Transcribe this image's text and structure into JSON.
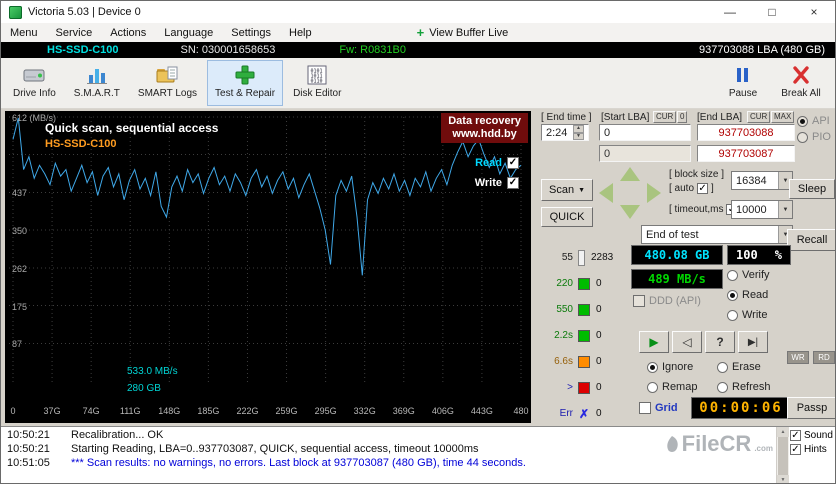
{
  "window": {
    "title": "Victoria 5.03 | Device 0"
  },
  "icons": {
    "minimize": "—",
    "maximize": "□",
    "close": "×",
    "view_buffer_plus": "+",
    "combo_arrow": "▼",
    "spinner_up": "▲",
    "spinner_down": "▼"
  },
  "menu": {
    "items": [
      "Menu",
      "Service",
      "Actions",
      "Language",
      "Settings",
      "Help"
    ],
    "buffer_live": "View Buffer Live"
  },
  "device": {
    "model": "HS-SSD-C100",
    "serial": "SN: 030001658653",
    "firmware": "Fw: R0831B0",
    "capacity": "937703088 LBA (480 GB)"
  },
  "toolbar": {
    "buttons": [
      {
        "label": "Drive Info"
      },
      {
        "label": "S.M.A.R.T"
      },
      {
        "label": "SMART Logs"
      },
      {
        "label": "Test & Repair",
        "active": true
      },
      {
        "label": "Disk Editor"
      }
    ],
    "pause": "Pause",
    "break_all": "Break All"
  },
  "graph": {
    "title": "Quick scan, sequential access",
    "subtitle": "HS-SSD-C100",
    "watermark_line1": "Data recovery",
    "watermark_line2": "www.hdd.by",
    "read_label": "Read",
    "write_label": "Write",
    "marker_speed": "533.0 MB/s",
    "marker_pos": "280 GB"
  },
  "chart_data": {
    "type": "line",
    "title": "Quick scan, sequential access",
    "ylabel": "MB/s",
    "ylim": [
      0,
      612
    ],
    "xlim": [
      0,
      480
    ],
    "grid": true,
    "y_ticks": [
      612,
      525,
      437,
      350,
      262,
      175,
      87
    ],
    "y_tick_labels": [
      "612 (MB/s)",
      "",
      "437",
      "350",
      "262",
      "175",
      "87"
    ],
    "x_tick_labels": [
      "0",
      "37G",
      "74G",
      "111G",
      "148G",
      "185G",
      "222G",
      "259G",
      "295G",
      "332G",
      "369G",
      "406G",
      "443G",
      "480"
    ],
    "series_color": "#3fa8e8",
    "legend": [
      "Read",
      "Write"
    ],
    "x": [
      0,
      5,
      10,
      15,
      20,
      25,
      30,
      35,
      40,
      45,
      50,
      55,
      60,
      65,
      70,
      75,
      80,
      85,
      90,
      95,
      100,
      105,
      110,
      115,
      120,
      125,
      130,
      135,
      140,
      145,
      150,
      155,
      160,
      165,
      170,
      175,
      180,
      185,
      190,
      195,
      200,
      205,
      210,
      215,
      220,
      225,
      230,
      235,
      240,
      245,
      250,
      255,
      260,
      265,
      270,
      275,
      280,
      285,
      290,
      295,
      300,
      305,
      310,
      315,
      320,
      325,
      330,
      335,
      340,
      345,
      350,
      355,
      360,
      365,
      370,
      375,
      380,
      385,
      390,
      395,
      400,
      405,
      410,
      415,
      420,
      425,
      430,
      435,
      440,
      445,
      450,
      455,
      460,
      465,
      470,
      475,
      480
    ],
    "values": [
      560,
      610,
      490,
      520,
      470,
      500,
      480,
      455,
      505,
      475,
      490,
      440,
      470,
      500,
      460,
      485,
      430,
      475,
      495,
      450,
      480,
      420,
      465,
      490,
      445,
      470,
      430,
      485,
      405,
      380,
      450,
      475,
      440,
      490,
      460,
      480,
      435,
      470,
      495,
      455,
      475,
      440,
      480,
      460,
      430,
      470,
      490,
      450,
      475,
      435,
      465,
      485,
      445,
      470,
      425,
      455,
      480,
      440,
      400,
      350,
      270,
      430,
      465,
      440,
      475,
      380,
      245,
      420,
      460,
      435,
      470,
      445,
      480,
      440,
      465,
      430,
      470,
      450,
      485,
      440,
      470,
      490,
      455,
      500,
      530,
      555,
      520,
      545,
      560,
      525,
      495,
      520,
      480,
      505,
      470,
      490,
      500
    ]
  },
  "controls": {
    "end_time_label": "[ End time ]",
    "end_time": "2:24",
    "start_lba_label": "[Start LBA]",
    "end_lba_label": "[End LBA]",
    "cur": "CUR",
    "zero": "0",
    "max": "MAX",
    "start_lba": "0",
    "current_lba": "0",
    "end_lba": "937703088",
    "end_lba_current": "937703087",
    "scan": "Scan",
    "quick": "QUICK",
    "block_size_label": "[ block size ]",
    "auto_label": "[ auto",
    "bracket": "]",
    "block_size": "16384",
    "timeout_label": "[ timeout,ms",
    "timeout": "10000",
    "end_of_test": "End of test",
    "api": "API",
    "pio": "PIO",
    "sleep": "Sleep",
    "recall": "Recall",
    "passp": "Passp",
    "wr": "WR",
    "rd": "RD"
  },
  "bins": [
    {
      "label": "55",
      "count": "2283",
      "swatch": "#f2f2f2",
      "label_color": "#202020",
      "tall": true
    },
    {
      "label": "220",
      "count": "0",
      "swatch": "#00bc00",
      "label_color": "#0a7a0a"
    },
    {
      "label": "550",
      "count": "0",
      "swatch": "#00bc00",
      "label_color": "#0a7a0a"
    },
    {
      "label": "2.2s",
      "count": "0",
      "swatch": "#00bc00",
      "label_color": "#0a7a0a"
    },
    {
      "label": "6.6s",
      "count": "0",
      "swatch": "#ff8c00",
      "label_color": "#96600a"
    },
    {
      "label": ">",
      "count": "0",
      "swatch": "#dc0000",
      "label_color": "#1a1ab0"
    },
    {
      "label": "Err",
      "count": "0",
      "glyph": "✗",
      "glyph_color": "#2a2ae0",
      "label_color": "#1a1ab0"
    }
  ],
  "status": {
    "size": "480.08 GB",
    "percent": "100",
    "percent_unit": "%",
    "speed": "489 MB/s",
    "modes": [
      "Verify",
      "Read",
      "Write"
    ],
    "mode_selected": "Read",
    "ddd": "DDD (API)",
    "actions": [
      "Ignore",
      "Erase",
      "Remap",
      "Refresh"
    ],
    "action_selected": "Ignore",
    "grid": "Grid",
    "timer": "00:00:06"
  },
  "transport": [
    {
      "name": "start",
      "glyph": "▶",
      "color": "#089018"
    },
    {
      "name": "step-back",
      "glyph": "◁",
      "color": "#303030"
    },
    {
      "name": "seek",
      "glyph": "?",
      "color": "#303030"
    },
    {
      "name": "to-end",
      "glyph": "▶|",
      "color": "#303030"
    }
  ],
  "log": {
    "rows": [
      {
        "time": "10:50:21",
        "text": "Recalibration... OK",
        "color": "#111111"
      },
      {
        "time": "10:50:21",
        "text": "Starting Reading, LBA=0..937703087, QUICK, sequential access, timeout 10000ms",
        "color": "#111111"
      },
      {
        "time": "10:51:05",
        "text": "*** Scan results: no warnings, no errors. Last block at 937703087 (480 GB), time 44 seconds.",
        "color": "#0000d8"
      }
    ],
    "sound": "Sound",
    "hints": "Hints",
    "watermark": "FileCR",
    "watermark_suffix": ".com"
  },
  "colors": {
    "model_cyan": "#00e0e0",
    "firmware_green": "#22d022",
    "size_cyan": "#00e4ff",
    "speed_green": "#00d800",
    "timer_amber": "#ffb400",
    "subtitle_orange": "#ff9c20",
    "marker_cyan": "#00d4d4",
    "read_legend_cyan": "#00d8ff",
    "grid_label_blue": "#2238c0"
  }
}
